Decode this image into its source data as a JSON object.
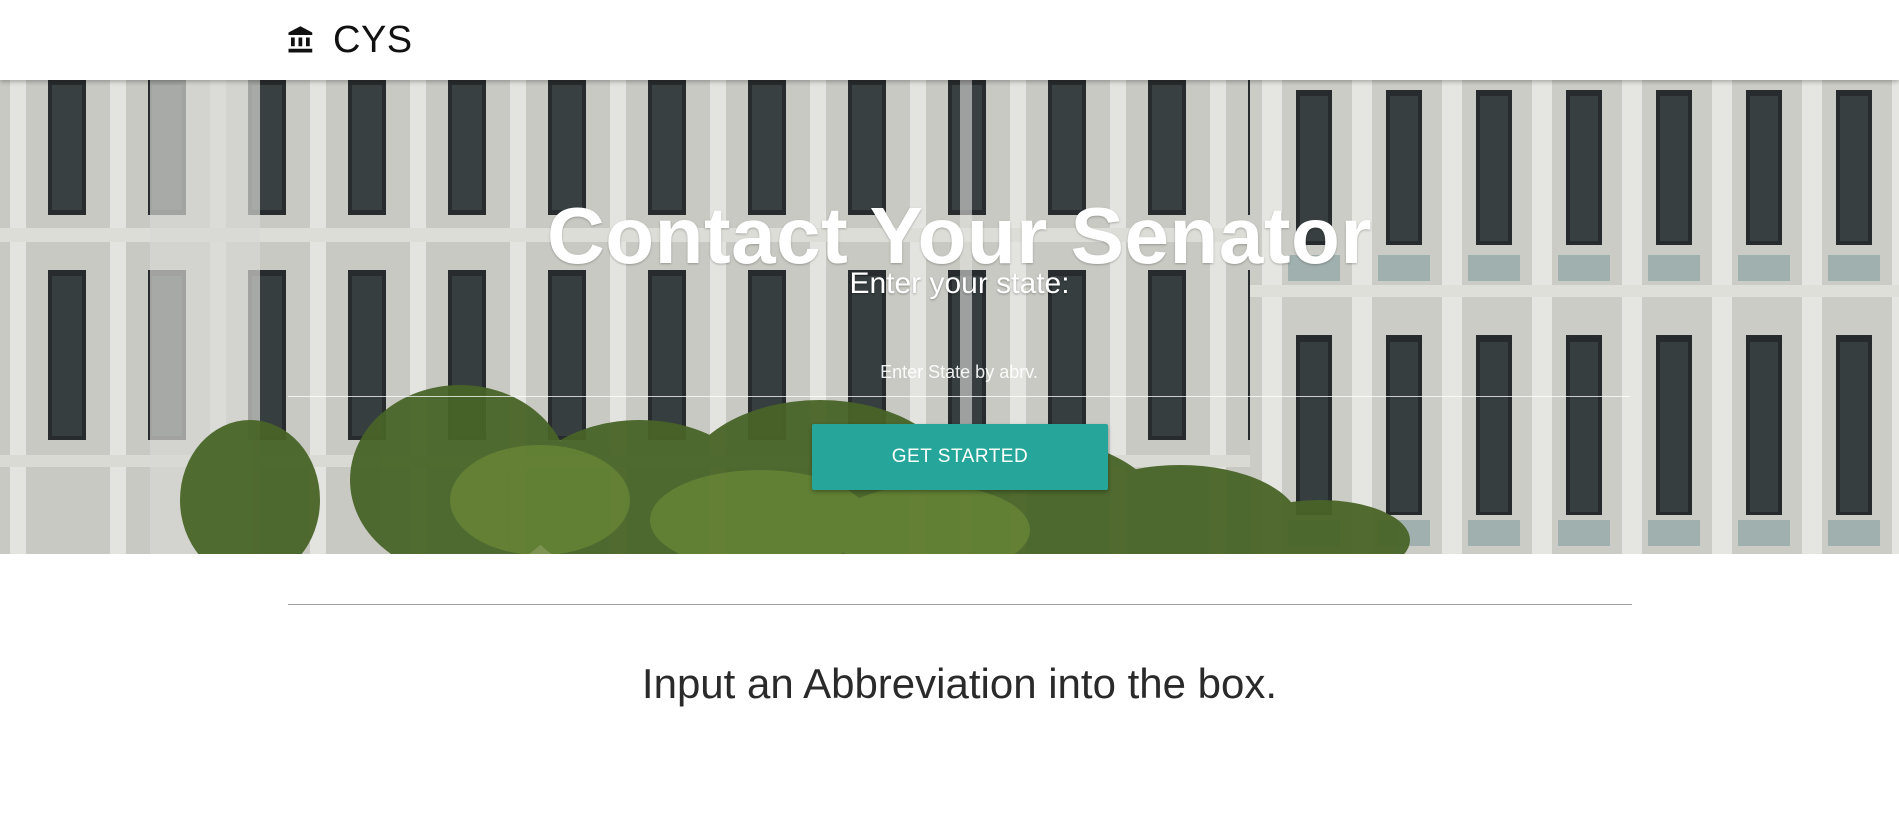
{
  "navbar": {
    "brand": "CYS",
    "brand_icon": "bank-building-icon"
  },
  "hero": {
    "title": "Contact Your Senator",
    "label": "Enter your state:",
    "input_placeholder": "Enter State by abrv.",
    "input_value": "",
    "button_label": "GET STARTED",
    "background": "senate-building-photo"
  },
  "main": {
    "instruction": "Input an Abbreviation into the box."
  },
  "colors": {
    "accent": "#26a69a",
    "navbar_bg": "#ffffff",
    "hero_text": "#ffffff"
  }
}
